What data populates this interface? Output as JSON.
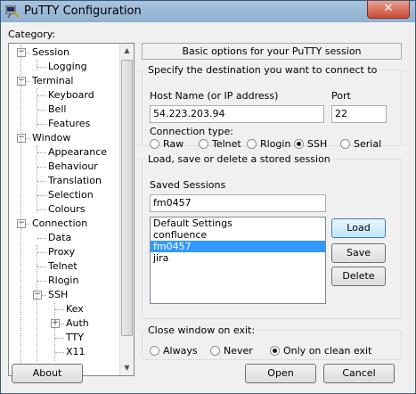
{
  "window": {
    "title": "PuTTY Configuration",
    "close_glyph": "✕"
  },
  "category_label": "Category:",
  "tree": [
    {
      "label": "Session",
      "level": 0,
      "expander": "−"
    },
    {
      "label": "Logging",
      "level": 1
    },
    {
      "label": "Terminal",
      "level": 0,
      "expander": "−"
    },
    {
      "label": "Keyboard",
      "level": 1
    },
    {
      "label": "Bell",
      "level": 1
    },
    {
      "label": "Features",
      "level": 1
    },
    {
      "label": "Window",
      "level": 0,
      "expander": "−"
    },
    {
      "label": "Appearance",
      "level": 1
    },
    {
      "label": "Behaviour",
      "level": 1
    },
    {
      "label": "Translation",
      "level": 1
    },
    {
      "label": "Selection",
      "level": 1
    },
    {
      "label": "Colours",
      "level": 1
    },
    {
      "label": "Connection",
      "level": 0,
      "expander": "−"
    },
    {
      "label": "Data",
      "level": 1
    },
    {
      "label": "Proxy",
      "level": 1
    },
    {
      "label": "Telnet",
      "level": 1
    },
    {
      "label": "Rlogin",
      "level": 1
    },
    {
      "label": "SSH",
      "level": 1,
      "expander": "−"
    },
    {
      "label": "Kex",
      "level": 2
    },
    {
      "label": "Auth",
      "level": 2,
      "expander": "+"
    },
    {
      "label": "TTY",
      "level": 2
    },
    {
      "label": "X11",
      "level": 2
    }
  ],
  "panel_header": "Basic options for your PuTTY session",
  "destination": {
    "legend": "Specify the destination you want to connect to",
    "host_label": "Host Name (or IP address)",
    "host_value": "54.223.203.94",
    "port_label": "Port",
    "port_value": "22",
    "conn_type_label": "Connection type:",
    "conn_types": [
      "Raw",
      "Telnet",
      "Rlogin",
      "SSH",
      "Serial"
    ],
    "selected_conn_type": "SSH"
  },
  "sessions": {
    "legend": "Load, save or delete a stored session",
    "saved_label": "Saved Sessions",
    "saved_value": "fm0457",
    "items": [
      "Default Settings",
      "confluence",
      "fm0457",
      "jira"
    ],
    "selected": "fm0457",
    "load": "Load",
    "save": "Save",
    "delete": "Delete"
  },
  "close_on_exit": {
    "legend": "Close window on exit:",
    "options": [
      "Always",
      "Never",
      "Only on clean exit"
    ],
    "selected": "Only on clean exit"
  },
  "buttons": {
    "about": "About",
    "open": "Open",
    "cancel": "Cancel"
  }
}
